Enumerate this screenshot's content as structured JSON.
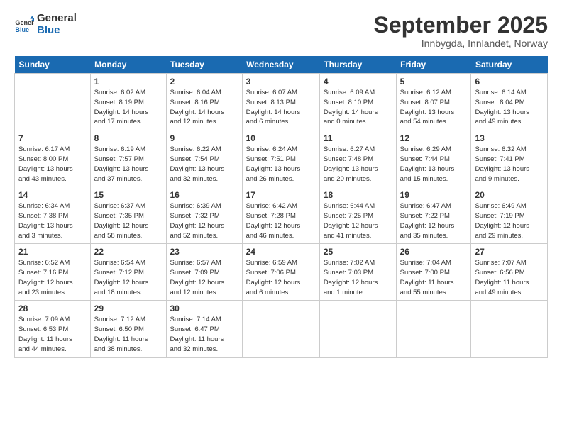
{
  "header": {
    "logo_line1": "General",
    "logo_line2": "Blue",
    "month": "September 2025",
    "location": "Innbygda, Innlandet, Norway"
  },
  "weekdays": [
    "Sunday",
    "Monday",
    "Tuesday",
    "Wednesday",
    "Thursday",
    "Friday",
    "Saturday"
  ],
  "weeks": [
    [
      {
        "day": "",
        "detail": ""
      },
      {
        "day": "1",
        "detail": "Sunrise: 6:02 AM\nSunset: 8:19 PM\nDaylight: 14 hours\nand 17 minutes."
      },
      {
        "day": "2",
        "detail": "Sunrise: 6:04 AM\nSunset: 8:16 PM\nDaylight: 14 hours\nand 12 minutes."
      },
      {
        "day": "3",
        "detail": "Sunrise: 6:07 AM\nSunset: 8:13 PM\nDaylight: 14 hours\nand 6 minutes."
      },
      {
        "day": "4",
        "detail": "Sunrise: 6:09 AM\nSunset: 8:10 PM\nDaylight: 14 hours\nand 0 minutes."
      },
      {
        "day": "5",
        "detail": "Sunrise: 6:12 AM\nSunset: 8:07 PM\nDaylight: 13 hours\nand 54 minutes."
      },
      {
        "day": "6",
        "detail": "Sunrise: 6:14 AM\nSunset: 8:04 PM\nDaylight: 13 hours\nand 49 minutes."
      }
    ],
    [
      {
        "day": "7",
        "detail": "Sunrise: 6:17 AM\nSunset: 8:00 PM\nDaylight: 13 hours\nand 43 minutes."
      },
      {
        "day": "8",
        "detail": "Sunrise: 6:19 AM\nSunset: 7:57 PM\nDaylight: 13 hours\nand 37 minutes."
      },
      {
        "day": "9",
        "detail": "Sunrise: 6:22 AM\nSunset: 7:54 PM\nDaylight: 13 hours\nand 32 minutes."
      },
      {
        "day": "10",
        "detail": "Sunrise: 6:24 AM\nSunset: 7:51 PM\nDaylight: 13 hours\nand 26 minutes."
      },
      {
        "day": "11",
        "detail": "Sunrise: 6:27 AM\nSunset: 7:48 PM\nDaylight: 13 hours\nand 20 minutes."
      },
      {
        "day": "12",
        "detail": "Sunrise: 6:29 AM\nSunset: 7:44 PM\nDaylight: 13 hours\nand 15 minutes."
      },
      {
        "day": "13",
        "detail": "Sunrise: 6:32 AM\nSunset: 7:41 PM\nDaylight: 13 hours\nand 9 minutes."
      }
    ],
    [
      {
        "day": "14",
        "detail": "Sunrise: 6:34 AM\nSunset: 7:38 PM\nDaylight: 13 hours\nand 3 minutes."
      },
      {
        "day": "15",
        "detail": "Sunrise: 6:37 AM\nSunset: 7:35 PM\nDaylight: 12 hours\nand 58 minutes."
      },
      {
        "day": "16",
        "detail": "Sunrise: 6:39 AM\nSunset: 7:32 PM\nDaylight: 12 hours\nand 52 minutes."
      },
      {
        "day": "17",
        "detail": "Sunrise: 6:42 AM\nSunset: 7:28 PM\nDaylight: 12 hours\nand 46 minutes."
      },
      {
        "day": "18",
        "detail": "Sunrise: 6:44 AM\nSunset: 7:25 PM\nDaylight: 12 hours\nand 41 minutes."
      },
      {
        "day": "19",
        "detail": "Sunrise: 6:47 AM\nSunset: 7:22 PM\nDaylight: 12 hours\nand 35 minutes."
      },
      {
        "day": "20",
        "detail": "Sunrise: 6:49 AM\nSunset: 7:19 PM\nDaylight: 12 hours\nand 29 minutes."
      }
    ],
    [
      {
        "day": "21",
        "detail": "Sunrise: 6:52 AM\nSunset: 7:16 PM\nDaylight: 12 hours\nand 23 minutes."
      },
      {
        "day": "22",
        "detail": "Sunrise: 6:54 AM\nSunset: 7:12 PM\nDaylight: 12 hours\nand 18 minutes."
      },
      {
        "day": "23",
        "detail": "Sunrise: 6:57 AM\nSunset: 7:09 PM\nDaylight: 12 hours\nand 12 minutes."
      },
      {
        "day": "24",
        "detail": "Sunrise: 6:59 AM\nSunset: 7:06 PM\nDaylight: 12 hours\nand 6 minutes."
      },
      {
        "day": "25",
        "detail": "Sunrise: 7:02 AM\nSunset: 7:03 PM\nDaylight: 12 hours\nand 1 minute."
      },
      {
        "day": "26",
        "detail": "Sunrise: 7:04 AM\nSunset: 7:00 PM\nDaylight: 11 hours\nand 55 minutes."
      },
      {
        "day": "27",
        "detail": "Sunrise: 7:07 AM\nSunset: 6:56 PM\nDaylight: 11 hours\nand 49 minutes."
      }
    ],
    [
      {
        "day": "28",
        "detail": "Sunrise: 7:09 AM\nSunset: 6:53 PM\nDaylight: 11 hours\nand 44 minutes."
      },
      {
        "day": "29",
        "detail": "Sunrise: 7:12 AM\nSunset: 6:50 PM\nDaylight: 11 hours\nand 38 minutes."
      },
      {
        "day": "30",
        "detail": "Sunrise: 7:14 AM\nSunset: 6:47 PM\nDaylight: 11 hours\nand 32 minutes."
      },
      {
        "day": "",
        "detail": ""
      },
      {
        "day": "",
        "detail": ""
      },
      {
        "day": "",
        "detail": ""
      },
      {
        "day": "",
        "detail": ""
      }
    ]
  ]
}
